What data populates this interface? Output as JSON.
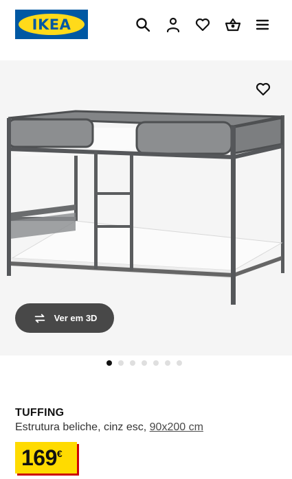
{
  "header": {
    "logo_text": "IKEA",
    "icons": [
      "search-icon",
      "user-icon",
      "heart-icon",
      "basket-icon",
      "menu-icon"
    ]
  },
  "gallery": {
    "favorite_icon": "heart-icon",
    "view_3d_label": "Ver em 3D",
    "view_3d_icon": "rotate-icon",
    "image_count": 7,
    "active_image": 1
  },
  "product": {
    "name": "TUFFING",
    "description": "Estrutura beliche, cinz esc, ",
    "size": "90x200 cm",
    "price": "169",
    "currency": "€"
  },
  "colors": {
    "brand_blue": "#0058a3",
    "brand_yellow": "#ffda1a",
    "price_yellow": "#ffdb00",
    "price_shadow": "#cc0008",
    "button_dark": "#484848"
  }
}
